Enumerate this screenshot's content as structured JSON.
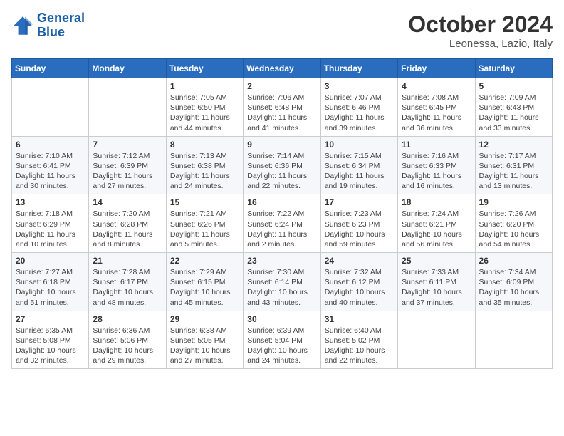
{
  "logo": {
    "line1": "General",
    "line2": "Blue"
  },
  "title": "October 2024",
  "subtitle": "Leonessa, Lazio, Italy",
  "headers": [
    "Sunday",
    "Monday",
    "Tuesday",
    "Wednesday",
    "Thursday",
    "Friday",
    "Saturday"
  ],
  "weeks": [
    [
      {
        "day": "",
        "detail": ""
      },
      {
        "day": "",
        "detail": ""
      },
      {
        "day": "1",
        "detail": "Sunrise: 7:05 AM\nSunset: 6:50 PM\nDaylight: 11 hours and 44 minutes."
      },
      {
        "day": "2",
        "detail": "Sunrise: 7:06 AM\nSunset: 6:48 PM\nDaylight: 11 hours and 41 minutes."
      },
      {
        "day": "3",
        "detail": "Sunrise: 7:07 AM\nSunset: 6:46 PM\nDaylight: 11 hours and 39 minutes."
      },
      {
        "day": "4",
        "detail": "Sunrise: 7:08 AM\nSunset: 6:45 PM\nDaylight: 11 hours and 36 minutes."
      },
      {
        "day": "5",
        "detail": "Sunrise: 7:09 AM\nSunset: 6:43 PM\nDaylight: 11 hours and 33 minutes."
      }
    ],
    [
      {
        "day": "6",
        "detail": "Sunrise: 7:10 AM\nSunset: 6:41 PM\nDaylight: 11 hours and 30 minutes."
      },
      {
        "day": "7",
        "detail": "Sunrise: 7:12 AM\nSunset: 6:39 PM\nDaylight: 11 hours and 27 minutes."
      },
      {
        "day": "8",
        "detail": "Sunrise: 7:13 AM\nSunset: 6:38 PM\nDaylight: 11 hours and 24 minutes."
      },
      {
        "day": "9",
        "detail": "Sunrise: 7:14 AM\nSunset: 6:36 PM\nDaylight: 11 hours and 22 minutes."
      },
      {
        "day": "10",
        "detail": "Sunrise: 7:15 AM\nSunset: 6:34 PM\nDaylight: 11 hours and 19 minutes."
      },
      {
        "day": "11",
        "detail": "Sunrise: 7:16 AM\nSunset: 6:33 PM\nDaylight: 11 hours and 16 minutes."
      },
      {
        "day": "12",
        "detail": "Sunrise: 7:17 AM\nSunset: 6:31 PM\nDaylight: 11 hours and 13 minutes."
      }
    ],
    [
      {
        "day": "13",
        "detail": "Sunrise: 7:18 AM\nSunset: 6:29 PM\nDaylight: 11 hours and 10 minutes."
      },
      {
        "day": "14",
        "detail": "Sunrise: 7:20 AM\nSunset: 6:28 PM\nDaylight: 11 hours and 8 minutes."
      },
      {
        "day": "15",
        "detail": "Sunrise: 7:21 AM\nSunset: 6:26 PM\nDaylight: 11 hours and 5 minutes."
      },
      {
        "day": "16",
        "detail": "Sunrise: 7:22 AM\nSunset: 6:24 PM\nDaylight: 11 hours and 2 minutes."
      },
      {
        "day": "17",
        "detail": "Sunrise: 7:23 AM\nSunset: 6:23 PM\nDaylight: 10 hours and 59 minutes."
      },
      {
        "day": "18",
        "detail": "Sunrise: 7:24 AM\nSunset: 6:21 PM\nDaylight: 10 hours and 56 minutes."
      },
      {
        "day": "19",
        "detail": "Sunrise: 7:26 AM\nSunset: 6:20 PM\nDaylight: 10 hours and 54 minutes."
      }
    ],
    [
      {
        "day": "20",
        "detail": "Sunrise: 7:27 AM\nSunset: 6:18 PM\nDaylight: 10 hours and 51 minutes."
      },
      {
        "day": "21",
        "detail": "Sunrise: 7:28 AM\nSunset: 6:17 PM\nDaylight: 10 hours and 48 minutes."
      },
      {
        "day": "22",
        "detail": "Sunrise: 7:29 AM\nSunset: 6:15 PM\nDaylight: 10 hours and 45 minutes."
      },
      {
        "day": "23",
        "detail": "Sunrise: 7:30 AM\nSunset: 6:14 PM\nDaylight: 10 hours and 43 minutes."
      },
      {
        "day": "24",
        "detail": "Sunrise: 7:32 AM\nSunset: 6:12 PM\nDaylight: 10 hours and 40 minutes."
      },
      {
        "day": "25",
        "detail": "Sunrise: 7:33 AM\nSunset: 6:11 PM\nDaylight: 10 hours and 37 minutes."
      },
      {
        "day": "26",
        "detail": "Sunrise: 7:34 AM\nSunset: 6:09 PM\nDaylight: 10 hours and 35 minutes."
      }
    ],
    [
      {
        "day": "27",
        "detail": "Sunrise: 6:35 AM\nSunset: 5:08 PM\nDaylight: 10 hours and 32 minutes."
      },
      {
        "day": "28",
        "detail": "Sunrise: 6:36 AM\nSunset: 5:06 PM\nDaylight: 10 hours and 29 minutes."
      },
      {
        "day": "29",
        "detail": "Sunrise: 6:38 AM\nSunset: 5:05 PM\nDaylight: 10 hours and 27 minutes."
      },
      {
        "day": "30",
        "detail": "Sunrise: 6:39 AM\nSunset: 5:04 PM\nDaylight: 10 hours and 24 minutes."
      },
      {
        "day": "31",
        "detail": "Sunrise: 6:40 AM\nSunset: 5:02 PM\nDaylight: 10 hours and 22 minutes."
      },
      {
        "day": "",
        "detail": ""
      },
      {
        "day": "",
        "detail": ""
      }
    ]
  ]
}
